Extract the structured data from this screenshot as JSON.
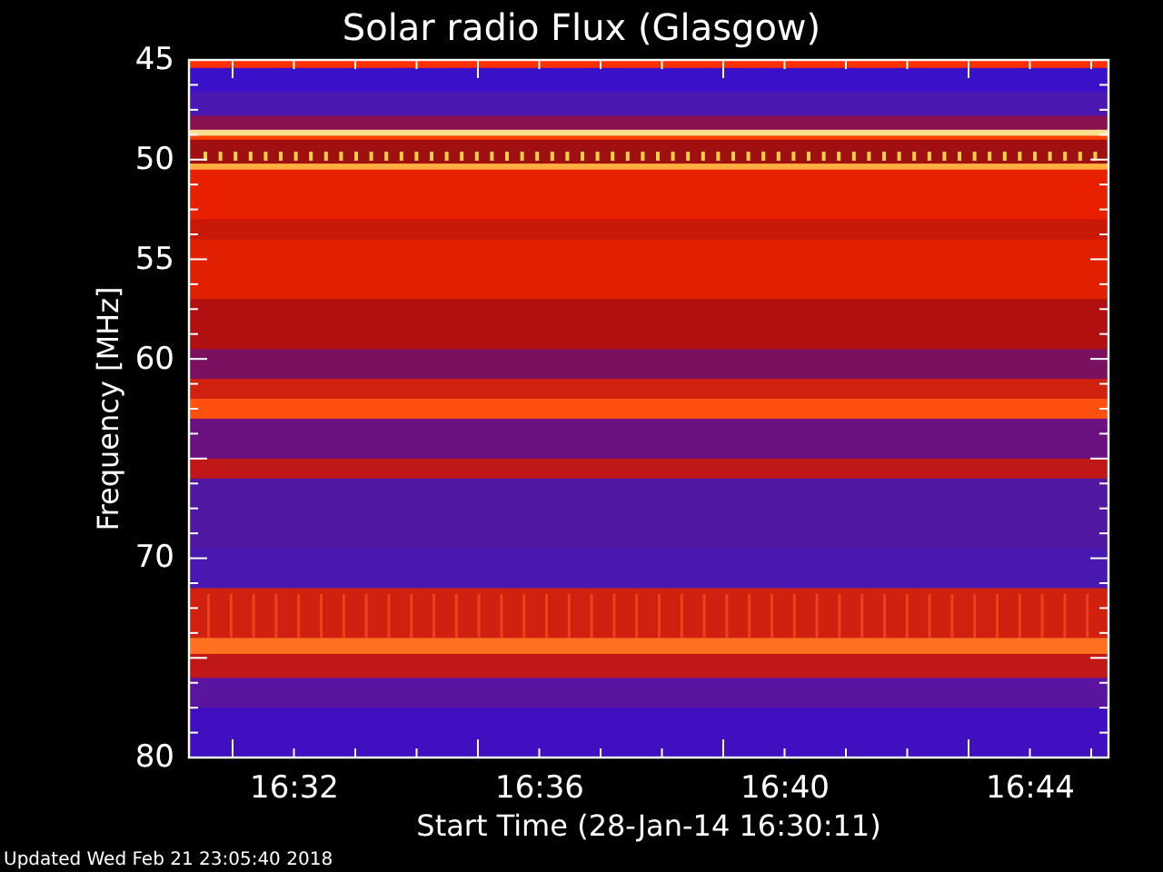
{
  "title": "Solar radio Flux (Glasgow)",
  "y_axis": {
    "label": "Frequency [MHz]",
    "ticks": [
      "45",
      "50",
      "55",
      "60",
      "70",
      "80"
    ]
  },
  "x_axis": {
    "label": "Start Time (28-Jan-14 16:30:11)",
    "ticks": [
      "16:32",
      "16:36",
      "16:40",
      "16:44"
    ]
  },
  "footer": "Updated Wed Feb 21 23:05:40 2018"
}
